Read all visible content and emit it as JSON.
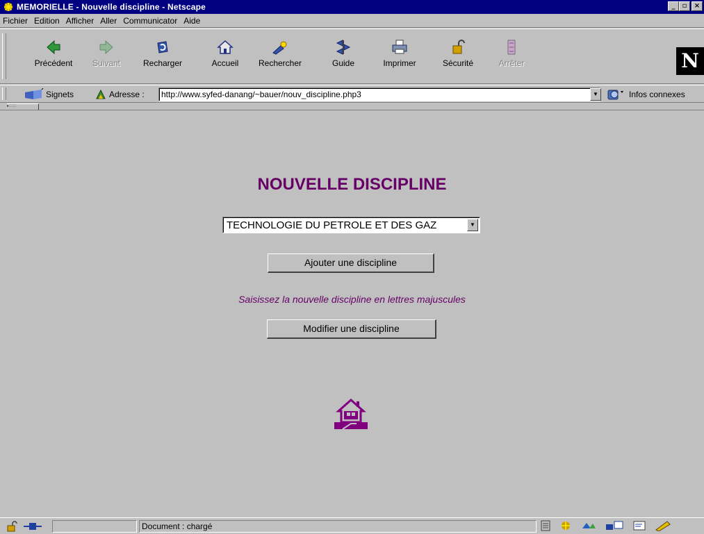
{
  "window": {
    "title": "MEMORIELLE - Nouvelle discipline - Netscape"
  },
  "menu": [
    {
      "label": "Fichier"
    },
    {
      "label": "Edition"
    },
    {
      "label": "Afficher"
    },
    {
      "label": "Aller"
    },
    {
      "label": "Communicator"
    },
    {
      "label": "Aide"
    }
  ],
  "toolbar": {
    "back": "Précédent",
    "forward": "Suivant",
    "reload": "Recharger",
    "home": "Accueil",
    "search": "Rechercher",
    "guide": "Guide",
    "print": "Imprimer",
    "security": "Sécurité",
    "stop": "Arrêter"
  },
  "locationbar": {
    "bookmarks": "Signets",
    "address_label": "Adresse :",
    "url": "http://www.syfed-danang/~bauer/nouv_discipline.php3",
    "related": "Infos connexes"
  },
  "page": {
    "title": "NOUVELLE DISCIPLINE",
    "discipline_selected": "TECHNOLOGIE DU PETROLE ET DES GAZ",
    "add_button": "Ajouter une discipline",
    "hint": "Saisissez la nouvelle discipline en lettres majuscules",
    "modify_button": "Modifier une discipline",
    "home_icon": "house-icon"
  },
  "status": {
    "text": "Document : chargé"
  },
  "colors": {
    "titlebar": "#000080",
    "accent_purple": "#660066",
    "chrome": "#c0c0c0"
  }
}
